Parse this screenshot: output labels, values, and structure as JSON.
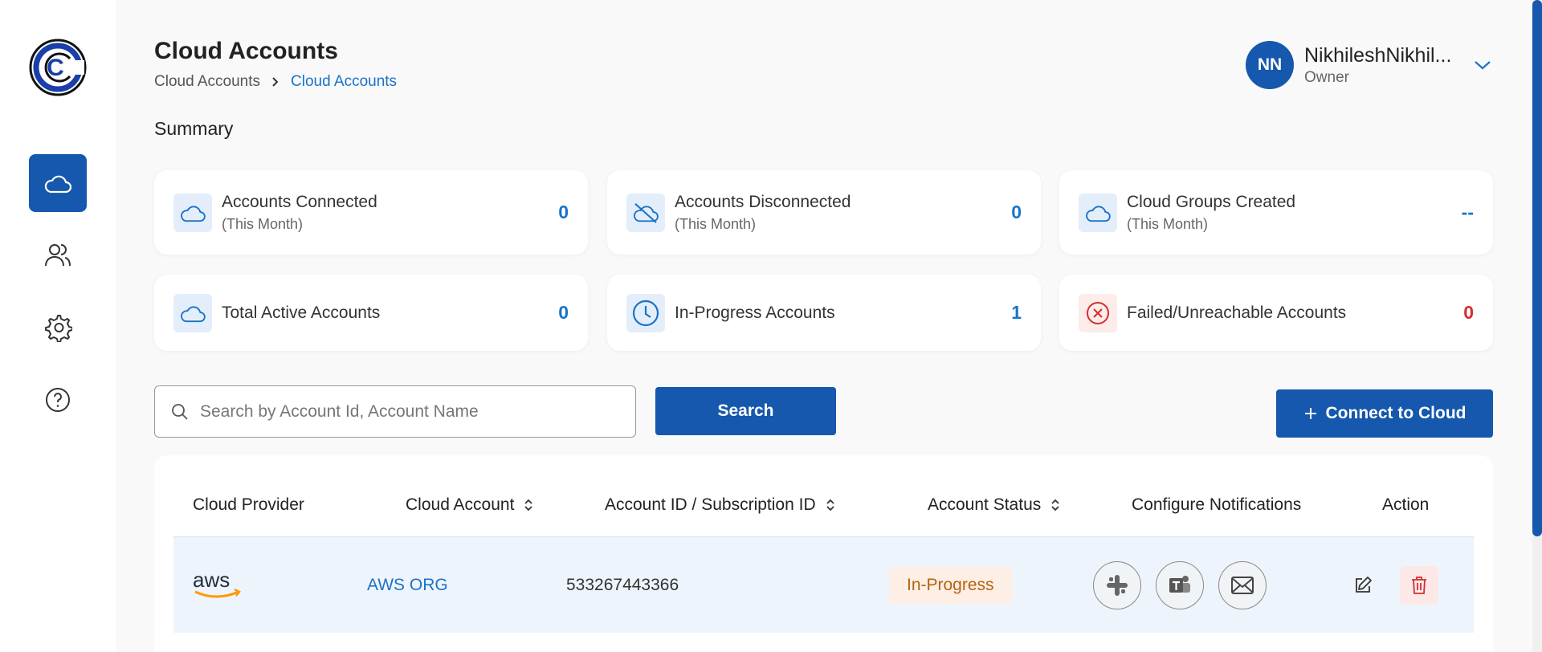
{
  "sidebar": {
    "logo_letter": "C",
    "items": [
      {
        "name": "cloud",
        "icon": "cloud-icon",
        "active": true
      },
      {
        "name": "users",
        "icon": "users-icon",
        "active": false
      },
      {
        "name": "settings",
        "icon": "gear-icon",
        "active": false
      },
      {
        "name": "help",
        "icon": "help-circle-icon",
        "active": false
      }
    ]
  },
  "header": {
    "title": "Cloud Accounts",
    "breadcrumb": [
      "Cloud Accounts",
      "Cloud Accounts"
    ]
  },
  "user": {
    "initials": "NN",
    "name": "NikhileshNikhil...",
    "role": "Owner"
  },
  "summary": {
    "label": "Summary",
    "cards": [
      {
        "title": "Accounts Connected",
        "subtitle": "(This Month)",
        "value": "0",
        "icon": "cloud-icon"
      },
      {
        "title": "Accounts Disconnected",
        "subtitle": "(This Month)",
        "value": "0",
        "icon": "cloud-off-icon"
      },
      {
        "title": "Cloud Groups Created",
        "subtitle": "(This Month)",
        "value": "--",
        "icon": "cloud-icon"
      },
      {
        "title": "Total Active Accounts",
        "value": "0",
        "icon": "cloud-icon"
      },
      {
        "title": "In-Progress Accounts",
        "value": "1",
        "icon": "clock-icon"
      },
      {
        "title": "Failed/Unreachable Accounts",
        "value": "0",
        "icon": "x-circle-icon"
      }
    ]
  },
  "search": {
    "placeholder": "Search by Account Id, Account Name",
    "value": "",
    "button_label": "Search"
  },
  "connect_button_label": "Connect to Cloud",
  "table": {
    "headers": [
      "Cloud Provider",
      "Cloud Account",
      "Account ID / Subscription ID",
      "Account Status",
      "Configure Notifications",
      "Action"
    ],
    "rows": [
      {
        "provider": "aws",
        "account": "AWS ORG",
        "account_id": "533267443366",
        "status": "In-Progress",
        "notifications": [
          "slack-icon",
          "teams-icon",
          "mail-icon"
        ],
        "actions": [
          "edit-icon",
          "trash-icon"
        ]
      }
    ]
  },
  "colors": {
    "primary": "#1558ad",
    "link": "#1a73c8",
    "danger": "#d32f2f",
    "status_bg": "#fdeee6",
    "status_text": "#b5640c",
    "aws_orange": "#ff9900"
  }
}
